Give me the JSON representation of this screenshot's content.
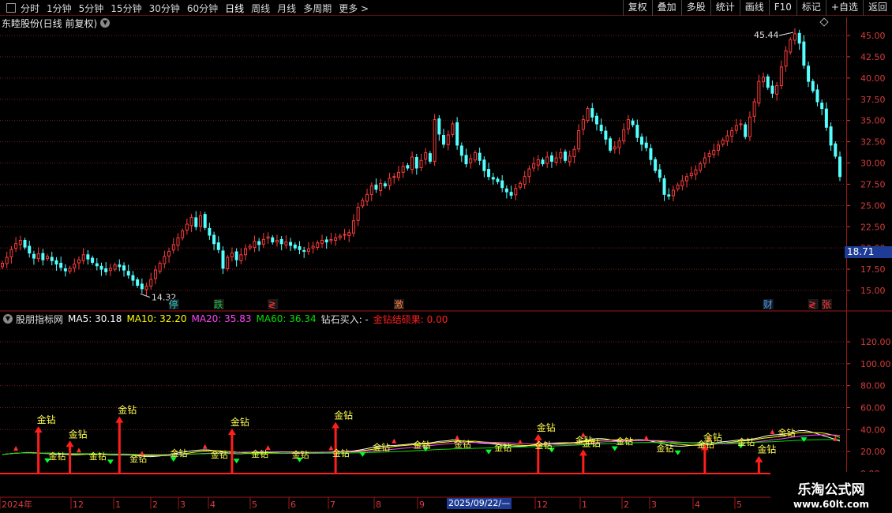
{
  "toolbar": {
    "periods": [
      "分时",
      "1分钟",
      "5分钟",
      "15分钟",
      "30分钟",
      "60分钟",
      "日线",
      "周线",
      "月线",
      "多周期",
      "更多 >"
    ],
    "active_period": "日线",
    "actions": [
      "复权",
      "叠加",
      "多股",
      "统计",
      "画线",
      "F10",
      "标记",
      "+自选",
      "返回"
    ]
  },
  "chart_title": "东睦股份(日线 前复权)",
  "indicator": {
    "name": "股朋指标网",
    "ma5_label": "MA5: 30.18",
    "ma10_label": "MA10: 32.20",
    "ma20_label": "MA20: 35.83",
    "ma60_label": "MA60: 36.34",
    "buy_label": "钻石买入: -",
    "result_label": "金钻结硕果: 0.00",
    "signal_text": "金钻"
  },
  "colors": {
    "up": "#ff3c3c",
    "down": "#54ffff",
    "ma5": "#ffffff",
    "ma10": "#ffff00",
    "ma20": "#ff44ff",
    "ma60": "#00e000",
    "grid": "#7a1a1a",
    "axis_text": "#d83c3c"
  },
  "current_price": "18.71",
  "high_label": "45.44",
  "low_label": "14.32",
  "event_tags": [
    {
      "text": "停",
      "color": "#2fd0d0",
      "at": 38
    },
    {
      "text": "跌",
      "color": "#20c040",
      "at": 48
    },
    {
      "text": "≷",
      "color": "#ff3030",
      "at": 60
    },
    {
      "text": "激",
      "color": "#ff8040",
      "at": 88
    },
    {
      "text": "财",
      "color": "#40a0ff",
      "at": 170
    },
    {
      "text": "≷",
      "color": "#ff3030",
      "at": 180
    },
    {
      "text": "张",
      "color": "#ff3030",
      "at": 183
    }
  ],
  "bottom_axis": {
    "labels": [
      "2024年",
      "12",
      "1",
      "2",
      "3",
      "4",
      "5",
      "6",
      "7",
      "8",
      "9",
      "12",
      "1",
      "2",
      "3",
      "4",
      "5"
    ],
    "selected_date": "2025/09/22/—"
  },
  "logo": {
    "line1": "乐淘公式网",
    "line2": "www.60lt.com"
  },
  "chart_data": [
    {
      "type": "candlestick",
      "ylim": [
        13.5,
        46.5
      ],
      "y_ticks": [
        "45.00",
        "42.50",
        "40.00",
        "37.50",
        "35.00",
        "32.50",
        "30.00",
        "27.50",
        "25.00",
        "22.50",
        "20.00",
        "17.50",
        "15.00"
      ],
      "close": [
        18.2,
        18.9,
        19.8,
        20.5,
        20.9,
        20.1,
        19.4,
        18.8,
        19.3,
        18.6,
        19.0,
        18.5,
        18.1,
        17.7,
        17.3,
        17.6,
        18.1,
        18.6,
        19.2,
        18.7,
        18.3,
        17.9,
        17.5,
        17.2,
        17.6,
        18.0,
        17.8,
        17.4,
        16.8,
        16.2,
        15.6,
        15.2,
        15.5,
        16.3,
        17.4,
        18.2,
        19.0,
        19.6,
        20.4,
        21.2,
        22.0,
        22.8,
        23.6,
        22.5,
        23.8,
        22.4,
        21.5,
        20.5,
        19.8,
        17.6,
        18.9,
        19.4,
        18.6,
        19.2,
        19.9,
        20.2,
        20.8,
        20.4,
        21.0,
        21.3,
        20.7,
        20.9,
        20.5,
        20.7,
        20.3,
        20.0,
        19.8,
        19.6,
        19.9,
        20.2,
        20.6,
        20.9,
        20.7,
        21.0,
        21.2,
        21.4,
        21.6,
        21.8,
        23.2,
        24.8,
        25.6,
        26.3,
        27.3,
        26.9,
        27.6,
        27.3,
        28.2,
        28.4,
        28.9,
        29.6,
        29.4,
        30.7,
        29.4,
        30.3,
        31.2,
        30.2,
        35.1,
        33.4,
        32.2,
        33.3,
        34.6,
        32.1,
        30.9,
        29.9,
        30.5,
        31.2,
        30.3,
        29.1,
        28.4,
        28.1,
        27.8,
        27.1,
        26.6,
        26.2,
        27.0,
        27.6,
        28.4,
        29.3,
        29.9,
        30.4,
        29.9,
        30.7,
        30.2,
        30.6,
        31.2,
        30.3,
        30.8,
        31.6,
        33.8,
        35.1,
        36.4,
        35.4,
        34.6,
        33.8,
        32.8,
        31.5,
        31.9,
        32.6,
        33.9,
        35.1,
        34.5,
        33.0,
        32.2,
        31.8,
        30.4,
        29.1,
        28.3,
        26.3,
        26.1,
        26.8,
        27.4,
        27.9,
        28.4,
        28.8,
        29.2,
        29.9,
        30.6,
        31.1,
        31.5,
        32.1,
        32.7,
        33.2,
        33.8,
        34.4,
        34.6,
        33.1,
        35.4,
        37.2,
        39.6,
        40.1,
        38.9,
        38.2,
        39.1,
        41.3,
        43.2,
        44.5,
        45.2,
        44.1,
        41.5,
        39.6,
        38.5,
        37.2,
        36.4,
        34.2,
        32.1,
        30.8,
        28.4
      ],
      "low_marker": "14.32",
      "high_marker": "45.44"
    },
    {
      "type": "line",
      "ylim": [
        0,
        130
      ],
      "y_ticks": [
        "120.00",
        "100.00",
        "80.00",
        "60.00",
        "40.00",
        "20.00",
        "0.00"
      ],
      "series": [
        {
          "name": "MA5",
          "color": "#ffffff"
        },
        {
          "name": "MA10",
          "color": "#ffff00"
        },
        {
          "name": "MA20",
          "color": "#ff44ff"
        },
        {
          "name": "MA60",
          "color": "#00e000"
        }
      ],
      "signals": [
        {
          "i": 8,
          "h": 43,
          "label": "金钻"
        },
        {
          "i": 15,
          "h": 30,
          "label": "金钻"
        },
        {
          "i": 26,
          "h": 52,
          "label": "金钻"
        },
        {
          "i": 51,
          "h": 41,
          "label": "金钻"
        },
        {
          "i": 74,
          "h": 47,
          "label": "金钻"
        },
        {
          "i": 119,
          "h": 36,
          "label": "金钻"
        },
        {
          "i": 129,
          "h": 22,
          "label": "金钻"
        },
        {
          "i": 156,
          "h": 27,
          "label": "金钻"
        },
        {
          "i": 168,
          "h": 16,
          "label": "金钻"
        },
        {
          "i": 206,
          "h": 15,
          "label": "金钻"
        }
      ]
    }
  ]
}
